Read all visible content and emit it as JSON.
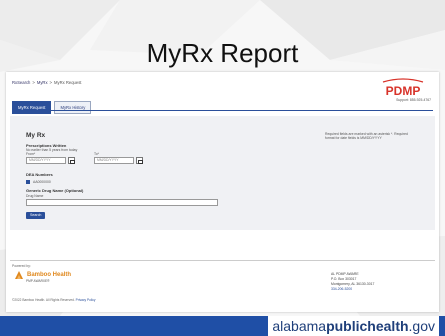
{
  "slide": {
    "title": "MyRx Report",
    "brand_prefix": "alabama",
    "brand_bold": "publichealth",
    "brand_suffix": ".gov"
  },
  "app": {
    "breadcrumb": [
      "RxSearch",
      "MyRx",
      "MyRx Request"
    ],
    "logo_text": "PDMP",
    "support_text": "Support: 855-925-4767",
    "tabs": [
      {
        "label": "MyRx Request",
        "active": true
      },
      {
        "label": "MyRx History",
        "active": false
      }
    ]
  },
  "form": {
    "title": "My Rx",
    "required_note": "Required fields are marked with an asterisk *. Required format for date fields is MM/DD/YYYY",
    "prescriptions_label": "Prescriptions Written",
    "prescriptions_hint": "No earlier than 5 years from today",
    "from_label": "From*",
    "to_label": "To*",
    "from_placeholder": "MM/DD/YYYY",
    "to_placeholder": "MM/DD/YYYY",
    "dea_label": "DEA Numbers",
    "dea_value": "AA0000000",
    "generic_label": "Generic Drug Name (Optional)",
    "drug_name_label": "Drug Name",
    "drug_name_value": "",
    "search_label": "Search"
  },
  "footer": {
    "powered_by": "Powered by:",
    "company": "Bamboo Health",
    "company_sub": "PMP AWARXE®",
    "copyright": "©2022 Bamboo Health. All Rights Reserved.",
    "privacy": "Privacy Policy",
    "address_lines": [
      "AL PDMP AWARE",
      "P.O. Box 303017",
      "Montgomery, AL 36130-3017"
    ],
    "phone": "334-206-5200"
  },
  "colors": {
    "brand_blue": "#1f4fa6",
    "tab_active": "#2a4f9a",
    "bamboo_orange": "#e0891f",
    "pdmp_red": "#d8332a"
  }
}
